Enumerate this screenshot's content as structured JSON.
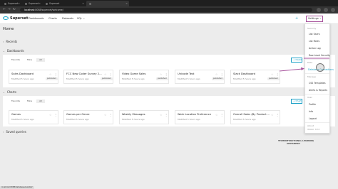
{
  "browser": {
    "tabs": [
      {
        "title": "Superset",
        "active": false
      },
      {
        "title": "Superset",
        "active": false
      },
      {
        "title": "Superset",
        "active": false
      },
      {
        "title": "",
        "active": true
      }
    ],
    "url_host": "localhost",
    "url_path": ":8088/superset/welcome/"
  },
  "header": {
    "logo": "Superset",
    "menu": [
      "Dashboards",
      "Charts",
      "Datasets",
      "SQL ⌄"
    ],
    "plus": "+",
    "settings": "Settings ⌄"
  },
  "page": {
    "title": "Home",
    "recents": "Recents",
    "dashboards": "Dashboards",
    "charts": "Charts",
    "saved_queries": "Saved queries"
  },
  "subtabs": [
    "Favorite",
    "Mine",
    "All"
  ],
  "add_dashboard": "+ Dashboard",
  "add_chart": "+ Chart",
  "dashboards": [
    {
      "title": "Sales Dashboard",
      "modified": "Modified 5 hours ago",
      "badge": "published"
    },
    {
      "title": "FCC New Coder Survey 2...",
      "modified": "Modified 5 hours ago",
      "badge": "published"
    },
    {
      "title": "Video Game Sales",
      "modified": "Modified 5 hours ago",
      "badge": "published"
    },
    {
      "title": "Unicode Test",
      "modified": "Modified 5 hours ago",
      "badge": "published"
    },
    {
      "title": "Slack Dashboard",
      "modified": "Modified 5 hours ago",
      "badge": "published"
    }
  ],
  "charts": [
    {
      "title": "Games",
      "modified": "Modified 5 hours ago"
    },
    {
      "title": "Games per Genre",
      "modified": "Modified 5 hours ago"
    },
    {
      "title": "Weekly Messages",
      "modified": "Modified 5 hours ago"
    },
    {
      "title": "Work Location Preference",
      "modified": "Modified 5 hours ago"
    },
    {
      "title": "Overall Sales (By Product ...",
      "modified": "Modified 5 hours ago"
    }
  ],
  "dropdown": {
    "security_label": "Security",
    "security_items": [
      "List Users",
      "List Roles",
      "Action Log",
      "Row Level Security"
    ],
    "data_label": "Data",
    "data_items": [
      "Database Connections"
    ],
    "manage_label": "Manage",
    "manage_items": [
      "CSS Templates",
      "Alerts & Reports"
    ],
    "user_label": "User",
    "user_items": [
      "Profile",
      "Info",
      "Logout"
    ],
    "about_label": "About",
    "version": "Version: 0.0.0"
  },
  "watermark_line1": "TECHNOFUNCTIONAL LEARNING",
  "watermark_line2": "AMITABHSH",
  "status_url": "localhost:8088/databaseview/list/",
  "colors": {
    "accent": "#1aa0c6",
    "annotation": "#a7529c"
  }
}
